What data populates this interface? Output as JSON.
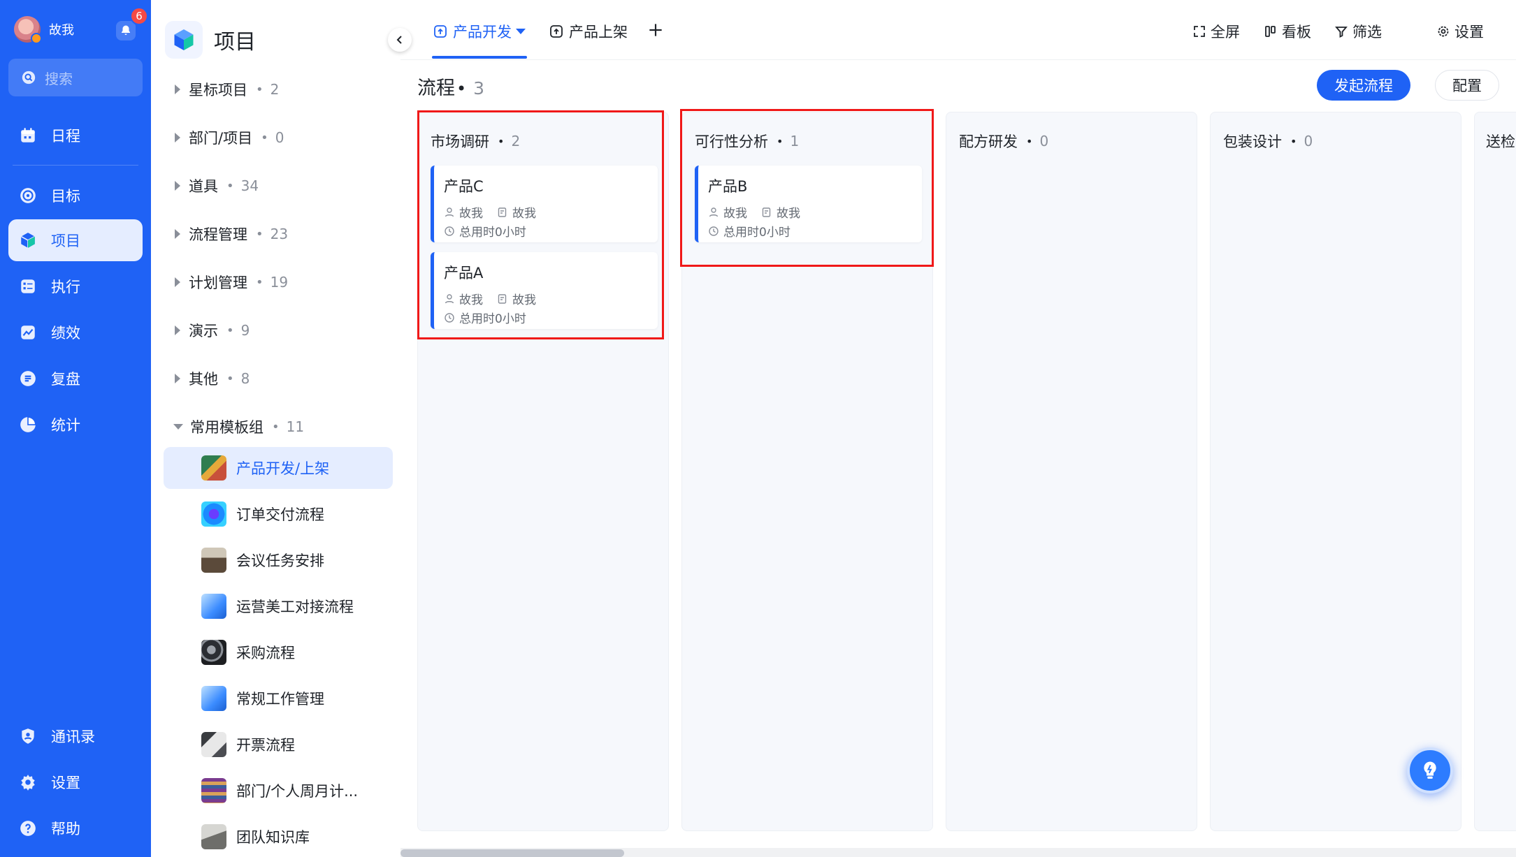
{
  "user": {
    "name": "故我",
    "notification_count": "6"
  },
  "search": {
    "placeholder": "搜索"
  },
  "nav": {
    "schedule": "日程",
    "goal": "目标",
    "project": "项目",
    "execute": "执行",
    "performance": "绩效",
    "review": "复盘",
    "stats": "统计",
    "contacts": "通讯录",
    "settings": "设置",
    "help": "帮助"
  },
  "panel": {
    "title": "项目",
    "groups": [
      {
        "label": "星标项目",
        "count": "2"
      },
      {
        "label": "部门/项目",
        "count": "0"
      },
      {
        "label": "道具",
        "count": "34"
      },
      {
        "label": "流程管理",
        "count": "23"
      },
      {
        "label": "计划管理",
        "count": "19"
      },
      {
        "label": "演示",
        "count": "9"
      },
      {
        "label": "其他",
        "count": "8"
      },
      {
        "label": "常用模板组",
        "count": "11"
      }
    ],
    "templates": [
      {
        "label": "产品开发/上架"
      },
      {
        "label": "订单交付流程"
      },
      {
        "label": "会议任务安排"
      },
      {
        "label": "运营美工对接流程"
      },
      {
        "label": "采购流程"
      },
      {
        "label": "常规工作管理"
      },
      {
        "label": "开票流程"
      },
      {
        "label": "部门/个人周月计..."
      },
      {
        "label": "团队知识库"
      }
    ]
  },
  "tabs": {
    "dev": "产品开发",
    "launch": "产品上架"
  },
  "toolbar": {
    "fullscreen": "全屏",
    "board": "看板",
    "filter": "筛选",
    "settings": "设置"
  },
  "flow": {
    "title": "流程",
    "count": "3",
    "start_button": "发起流程",
    "config_button": "配置"
  },
  "columns": [
    {
      "title": "市场调研",
      "count": "2",
      "cards": [
        {
          "title": "产品C",
          "owner": "故我",
          "creator": "故我",
          "time": "总用时0小时"
        },
        {
          "title": "产品A",
          "owner": "故我",
          "creator": "故我",
          "time": "总用时0小时"
        }
      ]
    },
    {
      "title": "可行性分析",
      "count": "1",
      "cards": [
        {
          "title": "产品B",
          "owner": "故我",
          "creator": "故我",
          "time": "总用时0小时"
        }
      ]
    },
    {
      "title": "配方研发",
      "count": "0",
      "cards": []
    },
    {
      "title": "包装设计",
      "count": "0",
      "cards": []
    },
    {
      "title": "送检",
      "count": "",
      "cards": []
    }
  ],
  "colors": {
    "accent": "#1f62f5",
    "highlight_box": "#f01919",
    "badge": "#f54a45"
  }
}
